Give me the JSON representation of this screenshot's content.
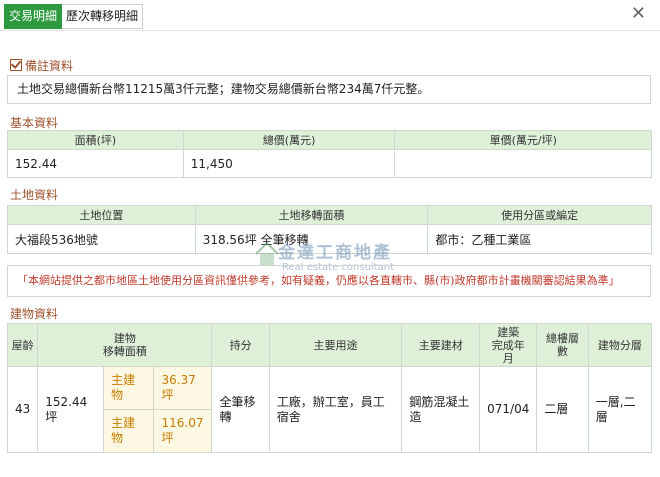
{
  "tabs": {
    "active": "交易明細",
    "inactive": "歷次轉移明細"
  },
  "close_icon": "close-icon",
  "remarks": {
    "title": "備註資料",
    "text": "土地交易總價新台幣11215萬3仟元整；建物交易總價新台幣234萬7仟元整。"
  },
  "basic": {
    "title": "基本資料",
    "headers": [
      "面積(坪)",
      "總價(萬元)",
      "單價(萬元/坪)"
    ],
    "values": [
      "152.44",
      "11,450",
      ""
    ]
  },
  "land": {
    "title": "土地資料",
    "headers": [
      "土地位置",
      "土地移轉面積",
      "使用分區或編定"
    ],
    "values": [
      "大福段536地號",
      "318.56坪 全筆移轉",
      "都市：乙種工業區"
    ]
  },
  "notice": "「本網站提供之都市地區土地使用分區資訊僅供參考，如有疑義，仍應以各直轄市、縣(市)政府都市計畫機關審認結果為準」",
  "watermark": {
    "title": "金達工商地產",
    "subtitle": "Real estate consultant"
  },
  "building": {
    "title": "建物資料",
    "headers": {
      "age": "屋齡",
      "area": "建物\n移轉面積",
      "share": "持分",
      "use": "主要用途",
      "material": "主要建材",
      "completed": "建築\n完成年\n月",
      "floors": "總樓層\n數",
      "layer": "建物分層"
    },
    "row": {
      "age": "43",
      "area": "152.44\n坪",
      "sub1_label": "主建\n物",
      "sub1_value": "36.37坪",
      "sub2_label": "主建\n物",
      "sub2_value": "116.07\n坪",
      "share": "全筆移\n轉",
      "use": "工廠，辦工室，員工\n宿舍",
      "material": "鋼筋混凝土\n造",
      "completed": "071/04",
      "floors": "二層",
      "layer": "一層,二\n層"
    }
  }
}
